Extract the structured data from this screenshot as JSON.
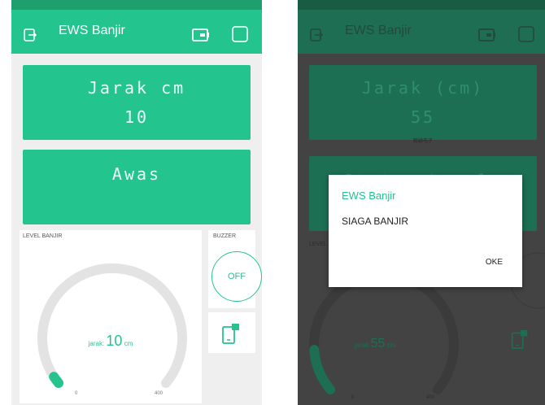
{
  "left_screen": {
    "app_title": "EWS Banjir",
    "lcd_top": {
      "line1": "Jarak cm",
      "line2": "10"
    },
    "lcd_bottom": {
      "line1": "Awas"
    },
    "gauge": {
      "label": "LEVEL BANJIR",
      "value_prefix": "jarak:",
      "value": "10",
      "unit": "cm",
      "min": "0",
      "max": "400",
      "fill_fraction": 0.025
    },
    "buzzer": {
      "label": "BUZZER",
      "state": "OFF"
    }
  },
  "right_screen": {
    "app_title": "EWS Banjir",
    "lcd_top": {
      "line1": "Jarak (cm)",
      "line2": "55"
    },
    "caption": "聪颖电子",
    "lcd_bottom": {
      "line1": "Status Level:"
    },
    "gauge": {
      "label": "LEVEL",
      "value_prefix": "jarak",
      "value": "55",
      "unit": "cm",
      "min": "0",
      "max": "400",
      "fill_fraction": 0.1375
    },
    "dialog": {
      "title": "EWS Banjir",
      "message": "SIAGA BANJIR",
      "button": "OKE"
    }
  },
  "colors": {
    "accent": "#23c48e",
    "dim_overlay": "#434343"
  },
  "icons": [
    "exit-icon",
    "device-icon",
    "square-icon",
    "tablet-icon"
  ]
}
